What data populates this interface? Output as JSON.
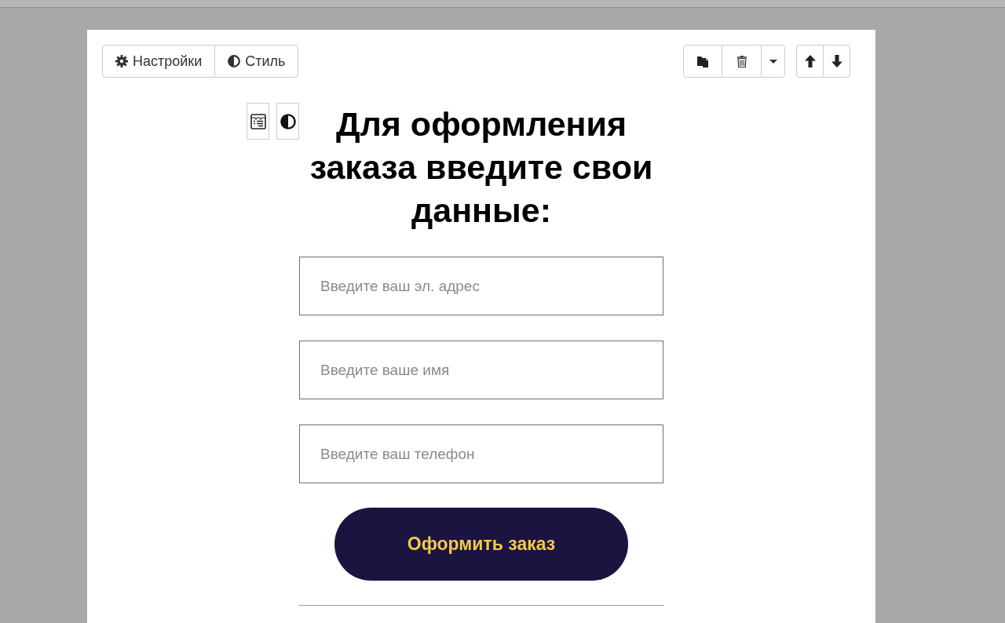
{
  "toolbar": {
    "buttons": [
      {
        "kind": "settings",
        "label": "Настройки"
      },
      {
        "kind": "style",
        "label": "Стиль"
      }
    ]
  },
  "heading": "Для оформления заказа введите свои данные:",
  "form": {
    "fields": [
      {
        "placeholder": "Введите ваш эл. адрес"
      },
      {
        "placeholder": "Введите ваше имя"
      },
      {
        "placeholder": "Введите ваш телефон"
      }
    ],
    "submit_button": "Оформить заказ"
  }
}
